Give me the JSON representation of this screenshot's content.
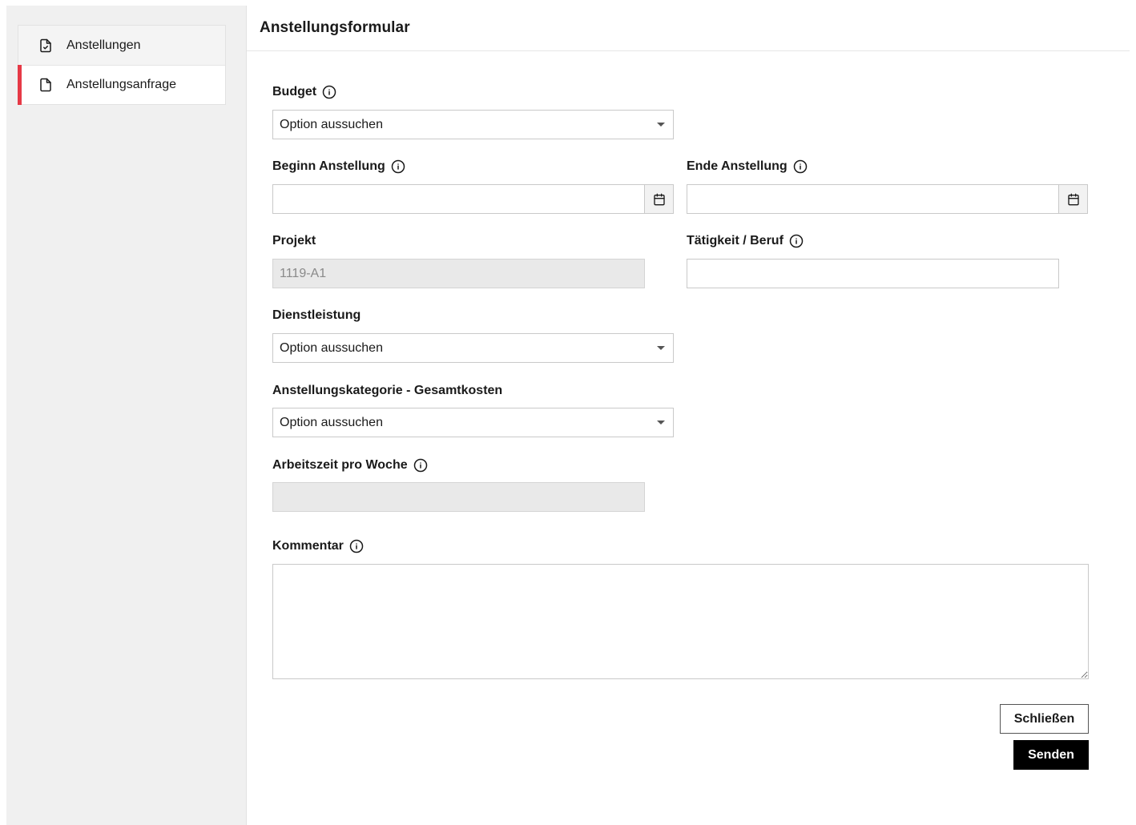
{
  "sidebar": {
    "items": [
      {
        "label": "Anstellungen",
        "icon": "file-check-icon",
        "active": false
      },
      {
        "label": "Anstellungsanfrage",
        "icon": "file-icon",
        "active": true
      }
    ]
  },
  "page": {
    "title": "Anstellungsformular"
  },
  "form": {
    "budget": {
      "label": "Budget",
      "value": "Option aussuchen"
    },
    "beginn": {
      "label": "Beginn Anstellung",
      "value": ""
    },
    "ende": {
      "label": "Ende Anstellung",
      "value": ""
    },
    "projekt": {
      "label": "Projekt",
      "value": "1119-A1"
    },
    "taetigkeit": {
      "label": "Tätigkeit / Beruf",
      "value": ""
    },
    "dienstleistung": {
      "label": "Dienstleistung",
      "value": "Option aussuchen"
    },
    "kategorie": {
      "label": "Anstellungskategorie - Gesamtkosten",
      "value": "Option aussuchen"
    },
    "arbeitszeit": {
      "label": "Arbeitszeit pro Woche",
      "value": ""
    },
    "kommentar": {
      "label": "Kommentar",
      "value": ""
    }
  },
  "actions": {
    "close_label": "Schließen",
    "send_label": "Senden"
  },
  "colors": {
    "active_accent": "#e63946",
    "primary_button": "#000000",
    "sidebar_bg": "#f0f0f0"
  }
}
